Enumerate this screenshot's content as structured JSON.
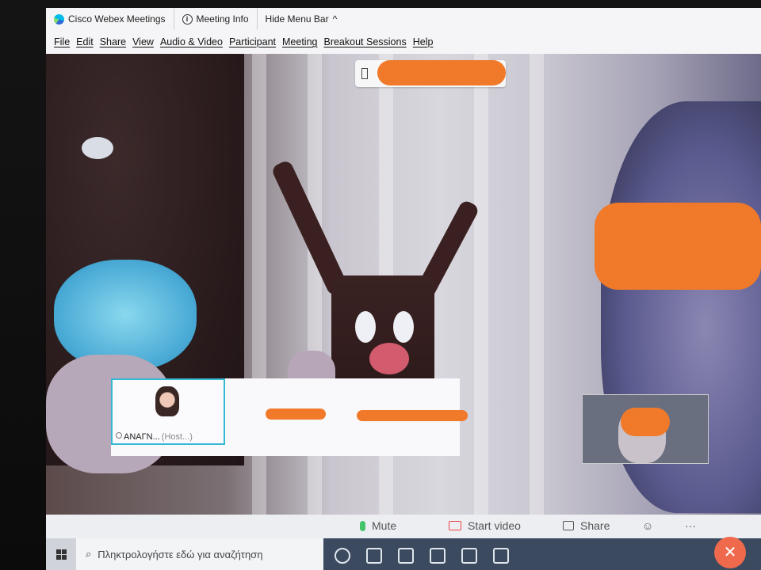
{
  "titlebar": {
    "app_title": "Cisco Webex Meetings",
    "meeting_info": "Meeting Info",
    "hide_menu": "Hide Menu Bar",
    "hide_menu_chevron": "^"
  },
  "menu": {
    "items": [
      "File",
      "Edit",
      "Share",
      "View",
      "Audio & Video",
      "Participant",
      "Meeting",
      "Breakout Sessions",
      "Help"
    ]
  },
  "participants": {
    "self_tile_name": "ΑΝΑΓΝ...",
    "self_tile_role": "(Host...)"
  },
  "controls": {
    "mute": "Mute",
    "start_video": "Start video",
    "share": "Share",
    "more": "···",
    "end": "✕"
  },
  "taskbar": {
    "search_placeholder": "Πληκτρολογήστε εδώ για αναζήτηση"
  },
  "colors": {
    "redaction": "#f07a2a",
    "tile_border": "#35b9d4",
    "end_button": "#ef6a4d",
    "mic": "#43c36a"
  }
}
